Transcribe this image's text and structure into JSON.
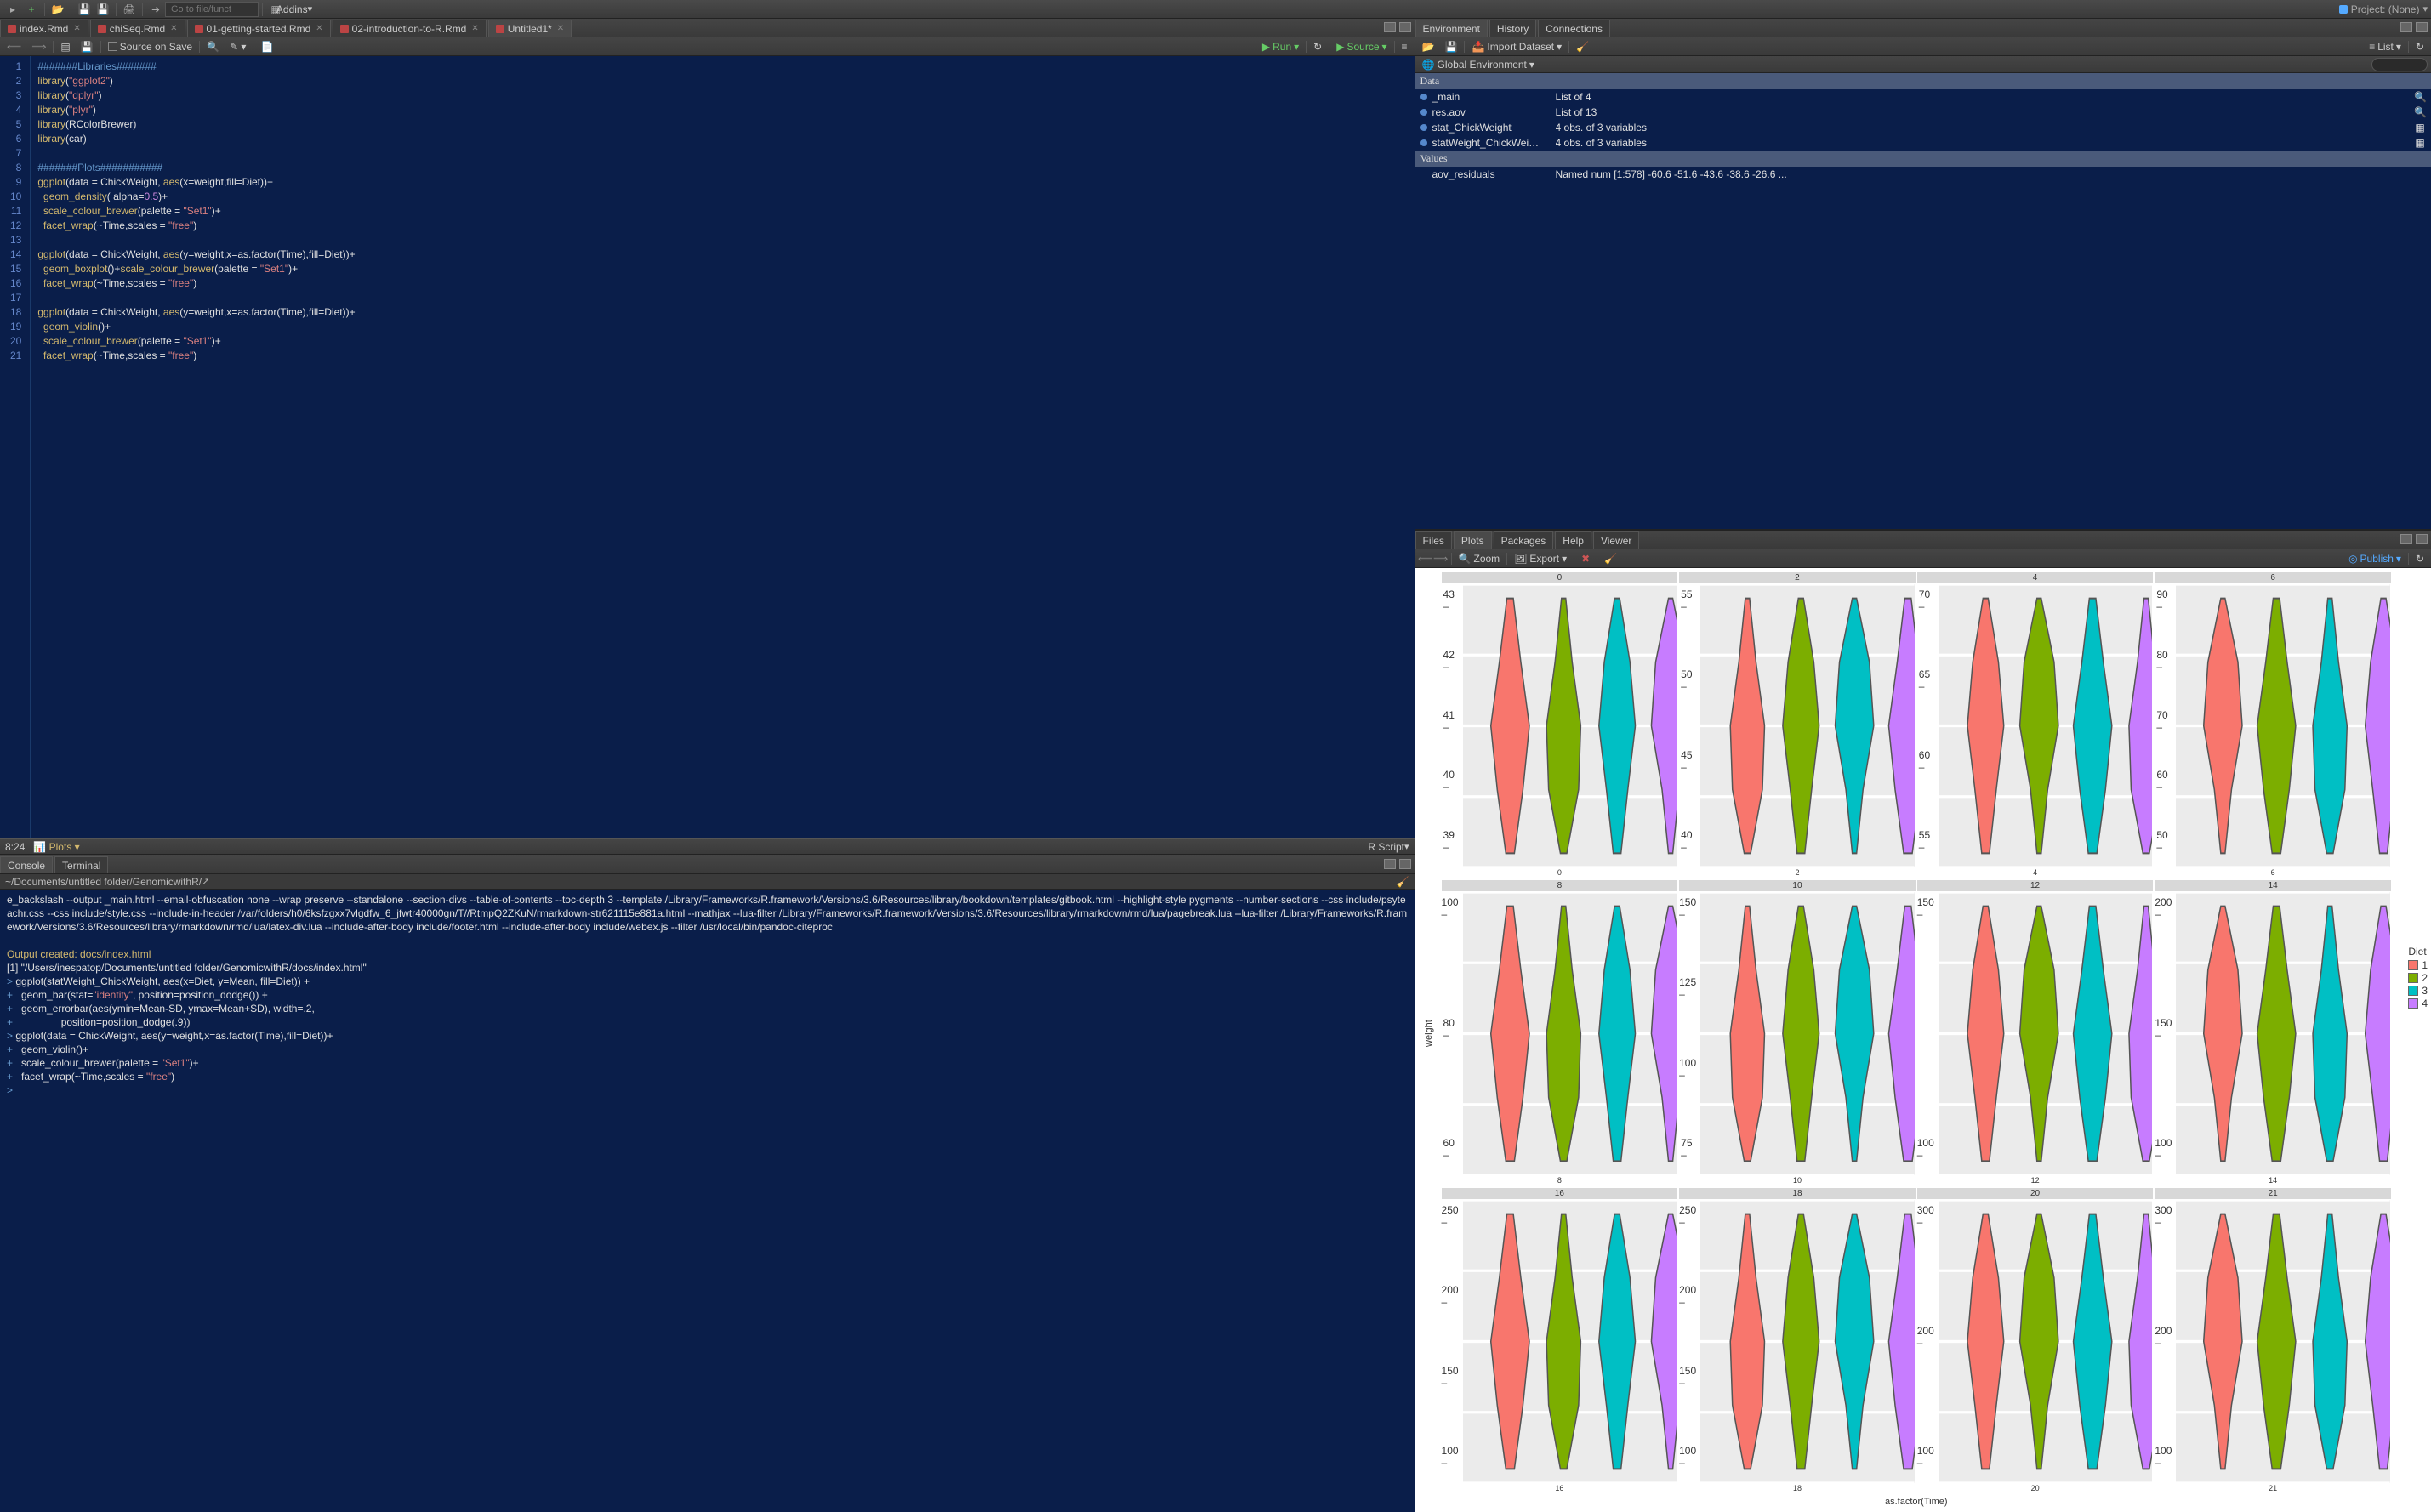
{
  "topbar": {
    "goto_placeholder": "Go to file/funct",
    "addins": "Addins",
    "project": "Project: (None)"
  },
  "editor_tabs": [
    {
      "label": "index.Rmd"
    },
    {
      "label": "chiSeq.Rmd"
    },
    {
      "label": "01-getting-started.Rmd"
    },
    {
      "label": "02-introduction-to-R.Rmd"
    },
    {
      "label": "Untitled1*",
      "active": true
    }
  ],
  "editor_toolbar": {
    "source_on_save": "Source on Save",
    "run": "Run",
    "source": "Source"
  },
  "editor_lines": [
    {
      "n": 1,
      "t": "#######Libraries#######",
      "cls": "c-comment"
    },
    {
      "n": 2,
      "html": "<span class='c-func'>library</span>(<span class='c-str'>\"ggplot2\"</span>)"
    },
    {
      "n": 3,
      "html": "<span class='c-func'>library</span>(<span class='c-str'>\"dplyr\"</span>)"
    },
    {
      "n": 4,
      "html": "<span class='c-func'>library</span>(<span class='c-str'>\"plyr\"</span>)"
    },
    {
      "n": 5,
      "html": "<span class='c-func'>library</span>(RColorBrewer)"
    },
    {
      "n": 6,
      "html": "<span class='c-func'>library</span>(car)"
    },
    {
      "n": 7,
      "t": ""
    },
    {
      "n": 8,
      "t": "#######Plots###########",
      "cls": "c-comment",
      "mark": true
    },
    {
      "n": 9,
      "html": "<span class='c-func'>ggplot</span>(data <span class='c-op'>=</span> ChickWeight, <span class='c-func'>aes</span>(x<span class='c-op'>=</span>weight,fill<span class='c-op'>=</span>Diet))<span class='c-op'>+</span>"
    },
    {
      "n": 10,
      "html": "  <span class='c-func'>geom_density</span>( alpha<span class='c-op'>=</span><span class='c-num'>0.5</span>)<span class='c-op'>+</span>"
    },
    {
      "n": 11,
      "html": "  <span class='c-func'>scale_colour_brewer</span>(palette <span class='c-op'>=</span> <span class='c-str'>\"Set1\"</span>)<span class='c-op'>+</span>"
    },
    {
      "n": 12,
      "html": "  <span class='c-func'>facet_wrap</span>(<span class='c-op'>~</span>Time,scales <span class='c-op'>=</span> <span class='c-str'>\"free\"</span>)"
    },
    {
      "n": 13,
      "t": ""
    },
    {
      "n": 14,
      "html": "<span class='c-func'>ggplot</span>(data <span class='c-op'>=</span> ChickWeight, <span class='c-func'>aes</span>(y<span class='c-op'>=</span>weight,x<span class='c-op'>=</span>as.factor(Time),fill<span class='c-op'>=</span>Diet))<span class='c-op'>+</span>"
    },
    {
      "n": 15,
      "html": "  <span class='c-func'>geom_boxplot</span>()<span class='c-op'>+</span><span class='c-func'>scale_colour_brewer</span>(palette <span class='c-op'>=</span> <span class='c-str'>\"Set1\"</span>)<span class='c-op'>+</span>"
    },
    {
      "n": 16,
      "html": "  <span class='c-func'>facet_wrap</span>(<span class='c-op'>~</span>Time,scales <span class='c-op'>=</span> <span class='c-str'>\"free\"</span>)"
    },
    {
      "n": 17,
      "t": ""
    },
    {
      "n": 18,
      "html": "<span class='c-func'>ggplot</span>(data <span class='c-op'>=</span> ChickWeight, <span class='c-func'>aes</span>(y<span class='c-op'>=</span>weight,x<span class='c-op'>=</span>as.factor(Time),fill<span class='c-op'>=</span>Diet))<span class='c-op'>+</span>"
    },
    {
      "n": 19,
      "html": "  <span class='c-func'>geom_violin</span>()<span class='c-op'>+</span>"
    },
    {
      "n": 20,
      "html": "  <span class='c-func'>scale_colour_brewer</span>(palette <span class='c-op'>=</span> <span class='c-str'>\"Set1\"</span>)<span class='c-op'>+</span>"
    },
    {
      "n": 21,
      "html": "  <span class='c-func'>facet_wrap</span>(<span class='c-op'>~</span>Time,scales <span class='c-op'>=</span> <span class='c-str'>\"free\"</span>)"
    }
  ],
  "editor_status": {
    "pos": "8:24",
    "section": "Plots",
    "type": "R Script"
  },
  "console_tabs": [
    {
      "label": "Console",
      "active": true
    },
    {
      "label": "Terminal"
    }
  ],
  "console_path": "~/Documents/untitled folder/GenomicwithR/",
  "console_lines": [
    {
      "cls": "cmd",
      "t": "e_backslash --output _main.html --email-obfuscation none --wrap preserve --standalone --section-divs --table-of-contents --toc-depth 3 --template /Library/Frameworks/R.framework/Versions/3.6/Resources/library/bookdown/templates/gitbook.html --highlight-style pygments --number-sections --css include/psyteachr.css --css include/style.css --include-in-header /var/folders/h0/6ksfzgxx7vlgdfw_6_jfwtr40000gn/T//RtmpQ2ZKuN/rmarkdown-str621115e881a.html --mathjax --lua-filter /Library/Frameworks/R.framework/Versions/3.6/Resources/library/rmarkdown/rmd/lua/pagebreak.lua --lua-filter /Library/Frameworks/R.framework/Versions/3.6/Resources/library/rmarkdown/rmd/lua/latex-div.lua --include-after-body include/footer.html --include-after-body include/webex.js --filter /usr/local/bin/pandoc-citeproc"
    },
    {
      "cls": "blank",
      "t": ""
    },
    {
      "cls": "out",
      "t": "Output created: docs/index.html"
    },
    {
      "cls": "cmd",
      "t": "[1] \"/Users/inespatop/Documents/untitled folder/GenomicwithR/docs/index.html\""
    },
    {
      "cls": "prompt",
      "t": "> ",
      "cont": "ggplot(statWeight_ChickWeight, aes(x=Diet, y=Mean, fill=Diet)) +"
    },
    {
      "cls": "prompt",
      "t": "+ ",
      "cont": "  geom_bar(stat=\"identity\", position=position_dodge()) +"
    },
    {
      "cls": "prompt",
      "t": "+ ",
      "cont": "  geom_errorbar(aes(ymin=Mean-SD, ymax=Mean+SD), width=.2,"
    },
    {
      "cls": "prompt",
      "t": "+ ",
      "cont": "                position=position_dodge(.9))"
    },
    {
      "cls": "prompt",
      "t": "> ",
      "cont": "ggplot(data = ChickWeight, aes(y=weight,x=as.factor(Time),fill=Diet))+"
    },
    {
      "cls": "prompt",
      "t": "+ ",
      "cont": "  geom_violin()+"
    },
    {
      "cls": "prompt",
      "t": "+ ",
      "cont": "  scale_colour_brewer(palette = \"Set1\")+"
    },
    {
      "cls": "prompt",
      "t": "+ ",
      "cont": "  facet_wrap(~Time,scales = \"free\")"
    },
    {
      "cls": "prompt",
      "t": "> ",
      "cont": ""
    }
  ],
  "env_tabs": [
    {
      "label": "Environment",
      "active": true
    },
    {
      "label": "History"
    },
    {
      "label": "Connections"
    }
  ],
  "env_toolbar": {
    "import": "Import Dataset",
    "list": "List",
    "scope": "Global Environment"
  },
  "env_sections": [
    {
      "title": "Data",
      "rows": [
        {
          "name": "_main",
          "val": "List of 4",
          "ico": "search"
        },
        {
          "name": "res.aov",
          "val": "List of 13",
          "ico": "search"
        },
        {
          "name": "stat_ChickWeight",
          "val": "4 obs. of  3 variables",
          "ico": "grid"
        },
        {
          "name": "statWeight_ChickWei…",
          "val": "4 obs. of  3 variables",
          "ico": "grid"
        }
      ]
    },
    {
      "title": "Values",
      "rows": [
        {
          "name": "aov_residuals",
          "val": "Named num [1:578] -60.6 -51.6 -43.6 -38.6 -26.6 ...",
          "nobullet": true
        }
      ]
    }
  ],
  "plot_tabs": [
    {
      "label": "Files"
    },
    {
      "label": "Plots",
      "active": true
    },
    {
      "label": "Packages"
    },
    {
      "label": "Help"
    },
    {
      "label": "Viewer"
    }
  ],
  "plot_toolbar": {
    "zoom": "Zoom",
    "export": "Export",
    "publish": "Publish"
  },
  "chart_data": {
    "type": "violin",
    "xlabel": "as.factor(Time)",
    "ylabel": "weight",
    "legend_title": "Diet",
    "legend_items": [
      "1",
      "2",
      "3",
      "4"
    ],
    "colors": [
      "#F8766D",
      "#7CAE00",
      "#00BFC4",
      "#C77CFF"
    ],
    "facets": [
      {
        "title": "0",
        "x": "0",
        "yticks": [
          "39",
          "40",
          "41",
          "42",
          "43"
        ]
      },
      {
        "title": "2",
        "x": "2",
        "yticks": [
          "40",
          "45",
          "50",
          "55"
        ]
      },
      {
        "title": "4",
        "x": "4",
        "yticks": [
          "55",
          "60",
          "65",
          "70"
        ]
      },
      {
        "title": "6",
        "x": "6",
        "yticks": [
          "50",
          "60",
          "70",
          "80",
          "90"
        ]
      },
      {
        "title": "8",
        "x": "8",
        "yticks": [
          "60",
          "80",
          "100"
        ]
      },
      {
        "title": "10",
        "x": "10",
        "yticks": [
          "75",
          "100",
          "125",
          "150"
        ]
      },
      {
        "title": "12",
        "x": "12",
        "yticks": [
          "100",
          "150"
        ]
      },
      {
        "title": "14",
        "x": "14",
        "yticks": [
          "100",
          "150",
          "200"
        ]
      },
      {
        "title": "16",
        "x": "16",
        "yticks": [
          "100",
          "150",
          "200",
          "250"
        ]
      },
      {
        "title": "18",
        "x": "18",
        "yticks": [
          "100",
          "150",
          "200",
          "250"
        ]
      },
      {
        "title": "20",
        "x": "20",
        "yticks": [
          "100",
          "200",
          "300"
        ]
      },
      {
        "title": "21",
        "x": "21",
        "yticks": [
          "100",
          "200",
          "300"
        ]
      }
    ]
  }
}
